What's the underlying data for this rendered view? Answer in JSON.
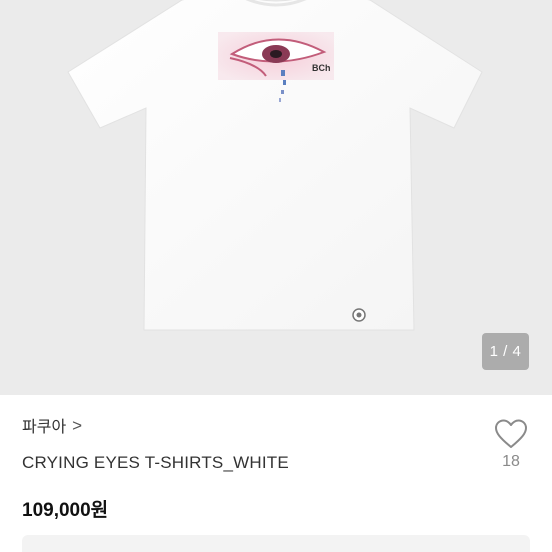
{
  "gallery": {
    "counter": "1 / 4",
    "shirt_print_text": "BCh"
  },
  "product": {
    "shop_name": "파쿠아",
    "shop_chevron": ">",
    "title": "CRYING EYES T-SHIRTS_WHITE",
    "price": "109,000원",
    "like_count": "18"
  },
  "colors": {
    "gallery_bg": "#ebebeb",
    "text_primary": "#111111",
    "text_secondary": "#8a8a8a"
  },
  "icons": {
    "like": "heart-outline-icon",
    "shop_link": "chevron-right-icon"
  }
}
